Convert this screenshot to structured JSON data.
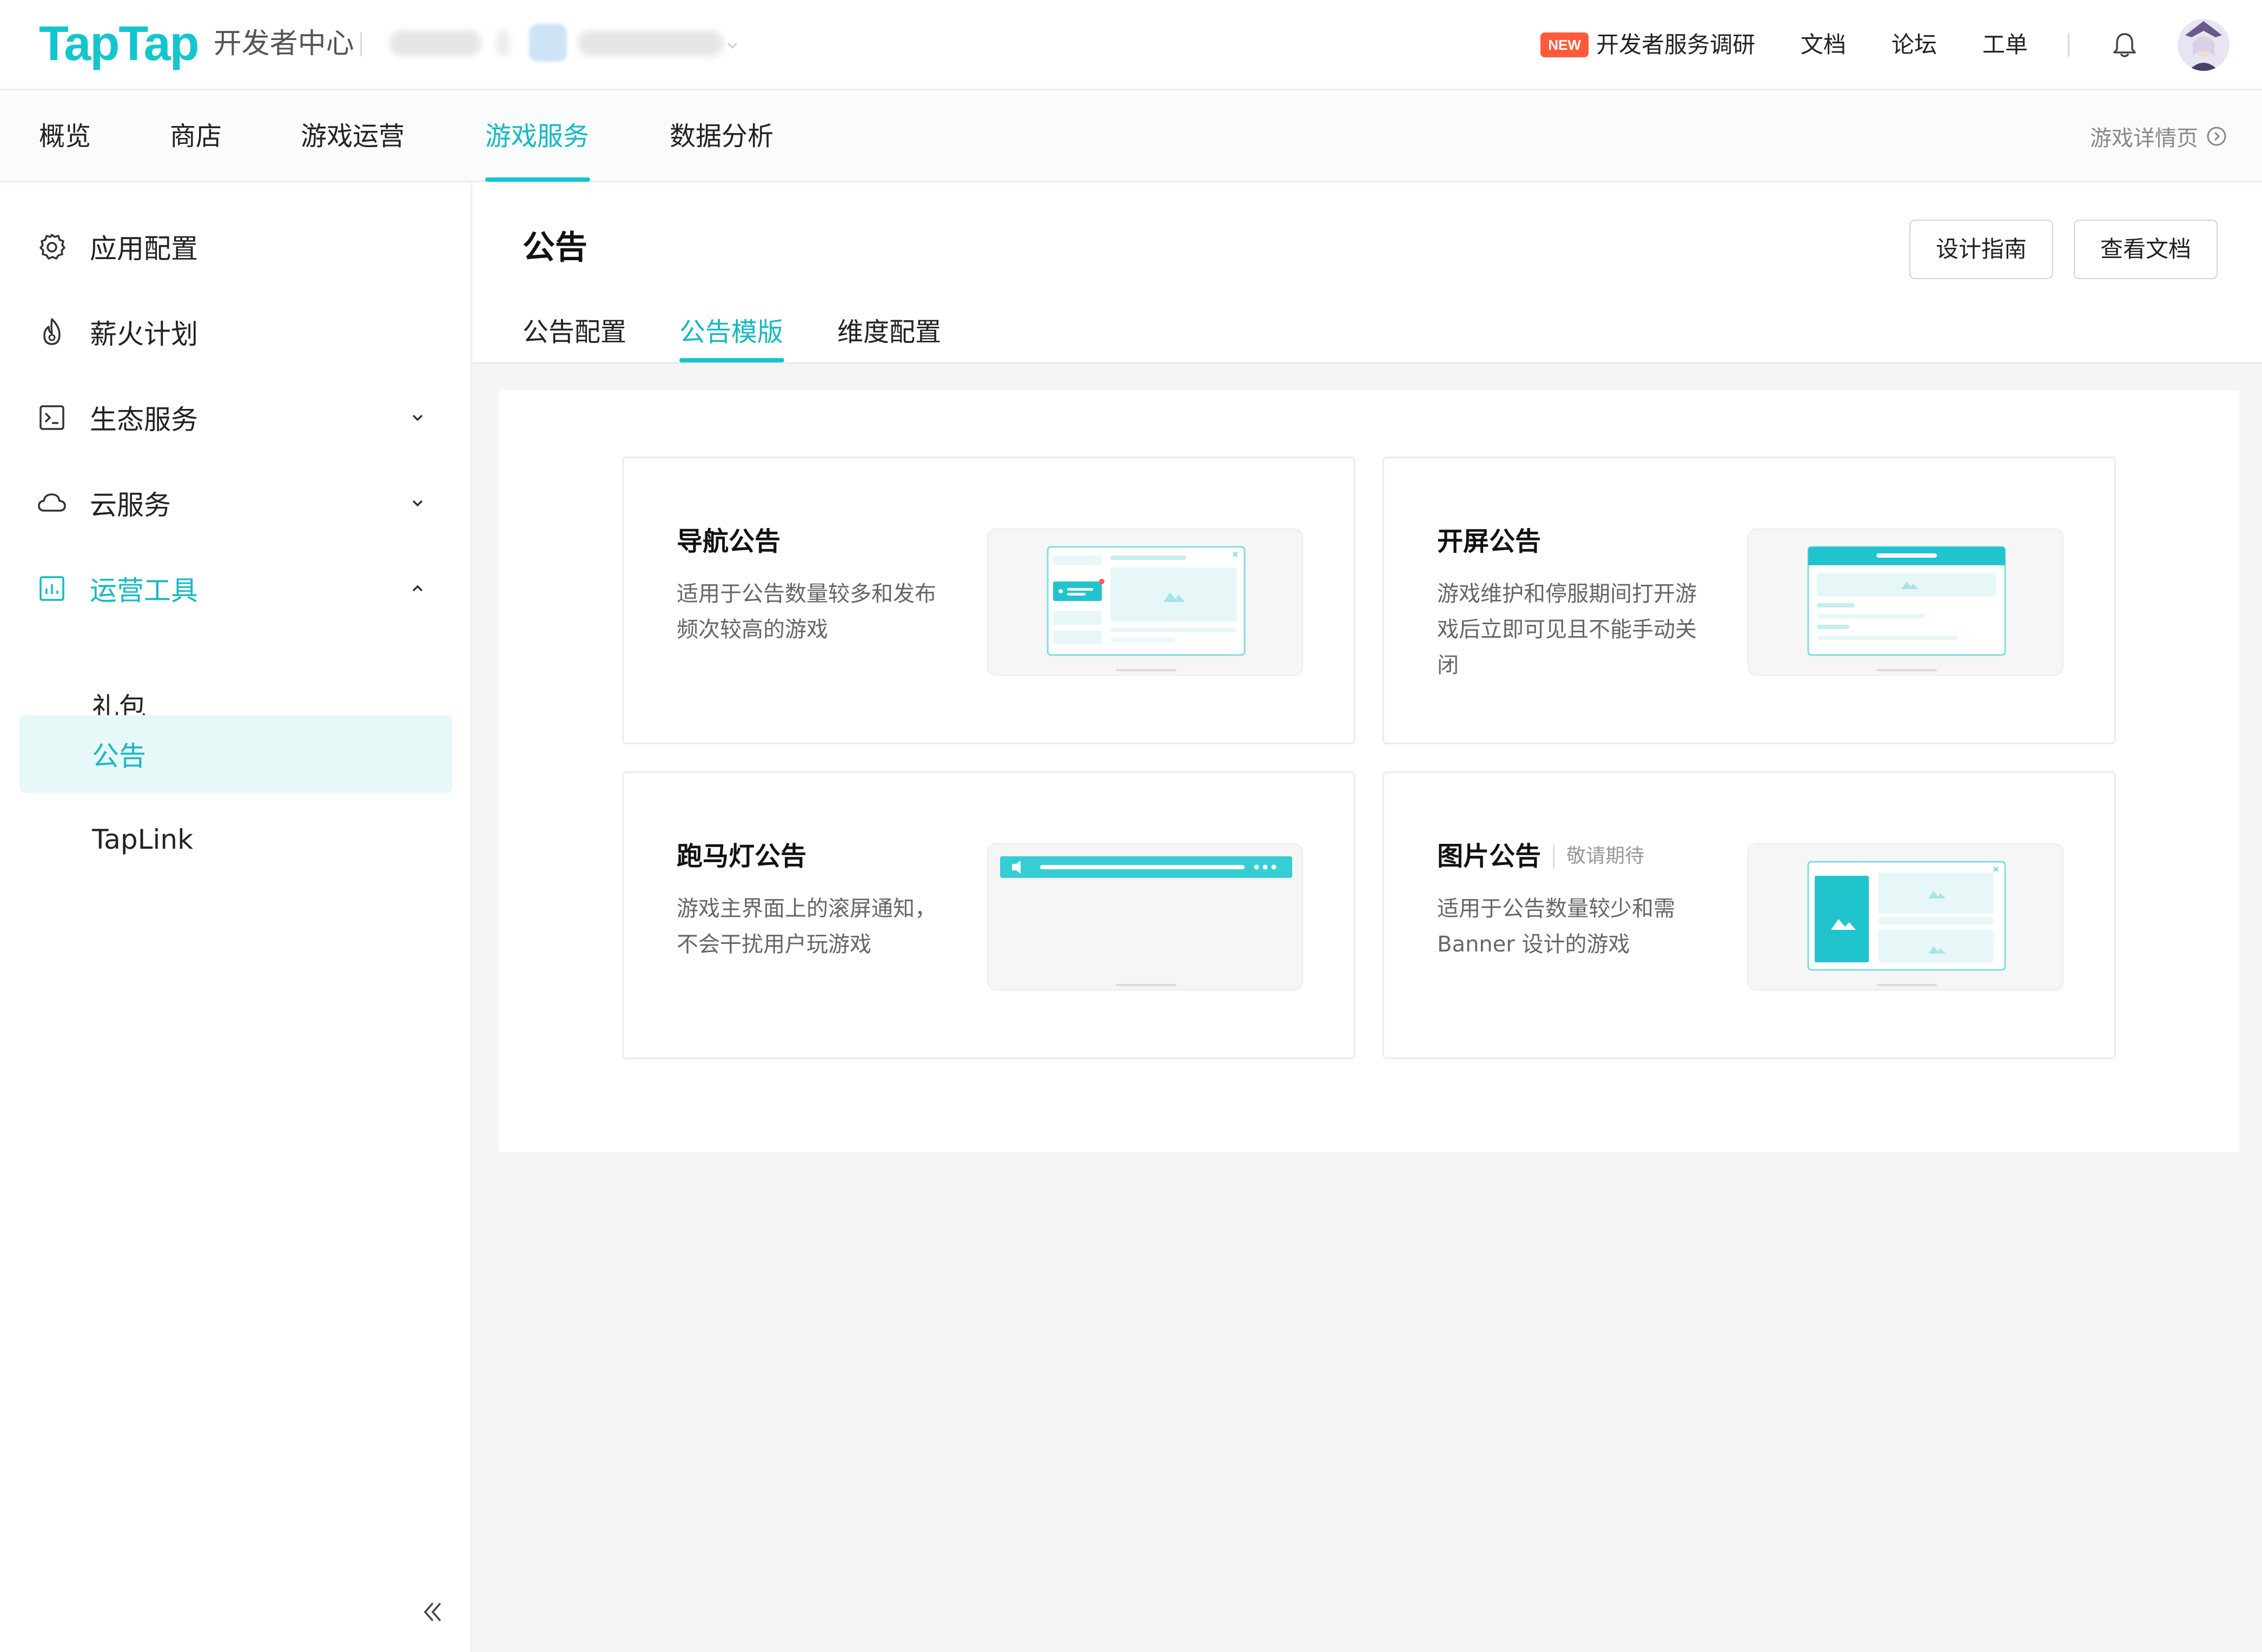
{
  "header": {
    "logo_text": "TapTap",
    "product": "开发者中心",
    "new_badge": "NEW",
    "links": [
      "开发者服务调研",
      "文档",
      "论坛",
      "工单"
    ]
  },
  "nav": {
    "items": [
      "概览",
      "商店",
      "游戏运营",
      "游戏服务",
      "数据分析"
    ],
    "active": "游戏服务",
    "game_detail": "游戏详情页"
  },
  "sidebar": {
    "items": [
      {
        "label": "应用配置",
        "icon": "gear-icon"
      },
      {
        "label": "薪火计划",
        "icon": "flame-icon"
      },
      {
        "label": "生态服务",
        "icon": "terminal-icon",
        "expandable": true
      },
      {
        "label": "云服务",
        "icon": "cloud-icon",
        "expandable": true
      },
      {
        "label": "运营工具",
        "icon": "chart-icon",
        "expandable": true,
        "expanded": true
      }
    ],
    "sub_items": [
      "礼包",
      "公告",
      "TapLink"
    ],
    "active_sub": "公告"
  },
  "main": {
    "title": "公告",
    "buttons": [
      "设计指南",
      "查看文档"
    ],
    "tabs": [
      "公告配置",
      "公告模版",
      "维度配置"
    ],
    "active_tab": "公告模版",
    "cards": [
      {
        "title": "导航公告",
        "desc": "适用于公告数量较多和发布频次较高的游戏",
        "tag": ""
      },
      {
        "title": "开屏公告",
        "desc": "游戏维护和停服期间打开游戏后立即可见且不能手动关闭",
        "tag": ""
      },
      {
        "title": "跑马灯公告",
        "desc": "游戏主界面上的滚屏通知，不会干扰用户玩游戏",
        "tag": ""
      },
      {
        "title": "图片公告",
        "desc": "适用于公告数量较少和需Banner 设计的游戏",
        "tag": "敬请期待"
      }
    ]
  },
  "colors": {
    "accent": "#15c5ce",
    "accent_text": "#15b9c2",
    "active_bg": "#e7f8f9",
    "new_badge": "#ff5a3c"
  }
}
